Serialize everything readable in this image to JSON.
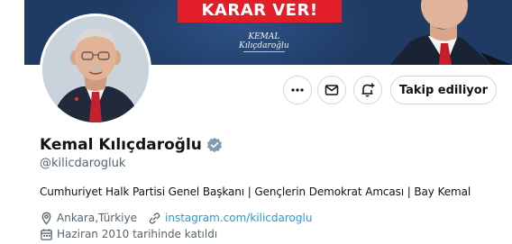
{
  "banner": {
    "slogan": "KARAR VER!",
    "signature_line1": "KEMAL",
    "signature_line2": "Kılıçdaroğlu",
    "colors": {
      "navy": "#1f3a63",
      "red": "#e21e29"
    }
  },
  "avatar": {
    "icon": "profile-photo"
  },
  "actions": {
    "more_icon": "ellipsis-icon",
    "message_icon": "envelope-icon",
    "notify_icon": "bell-plus-icon",
    "follow_label": "Takip ediliyor"
  },
  "profile": {
    "display_name": "Kemal Kılıçdaroğlu",
    "verified_icon": "verified-badge-icon",
    "handle": "@kilicdarogluk",
    "bio": "Cumhuriyet Halk Partisi Genel Başkanı | Gençlerin Demokrat Amcası | Bay Kemal",
    "location": "Ankara,Türkiye",
    "website": "instagram.com/kilicdaroglu",
    "joined": "Haziran 2010 tarihinde katıldı"
  },
  "colors": {
    "text_primary": "#0f1419",
    "text_secondary": "#536471",
    "link": "#1d9bf0",
    "verified_badge": "#829aab",
    "border": "#cfd9de"
  }
}
